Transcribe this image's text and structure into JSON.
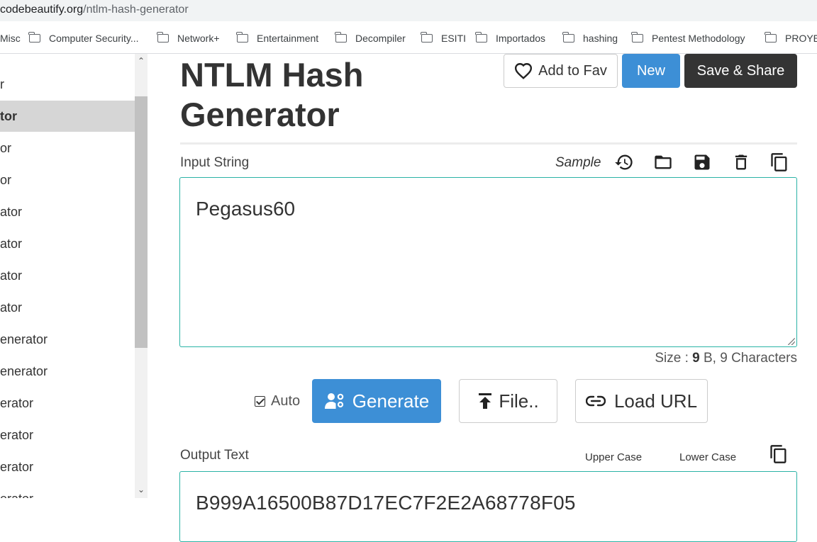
{
  "browser": {
    "url_host": "codebeautify.org",
    "url_path": "/ntlm-hash-generator"
  },
  "bookmarks": [
    {
      "label": "Misc",
      "icon": "folder-icon"
    },
    {
      "label": "Computer Security...",
      "icon": "folder-icon"
    },
    {
      "label": "Network+",
      "icon": "folder-icon"
    },
    {
      "label": "Entertainment",
      "icon": "folder-icon"
    },
    {
      "label": "Decompiler",
      "icon": "folder-icon"
    },
    {
      "label": "ESITI",
      "icon": "folder-icon"
    },
    {
      "label": "Importados",
      "icon": "folder-icon"
    },
    {
      "label": "hashing",
      "icon": "folder-icon"
    },
    {
      "label": "Pentest Methodology",
      "icon": "folder-icon"
    },
    {
      "label": "PROYEC",
      "icon": "folder-icon"
    }
  ],
  "sidebar": {
    "items": [
      {
        "label": "r"
      },
      {
        "label": "tor",
        "active": true
      },
      {
        "label": "or"
      },
      {
        "label": "or"
      },
      {
        "label": "ator"
      },
      {
        "label": "ator"
      },
      {
        "label": "ator"
      },
      {
        "label": "ator"
      },
      {
        "label": "enerator"
      },
      {
        "label": "enerator"
      },
      {
        "label": "erator"
      },
      {
        "label": "erator"
      },
      {
        "label": "erator"
      },
      {
        "label": "erator"
      }
    ]
  },
  "main": {
    "title": "NTLM Hash Generator",
    "add_to_fav": "Add to Fav",
    "new_label": "New",
    "save_share_label": "Save & Share",
    "input_label": "Input String",
    "sample_label": "Sample",
    "input_value": "Pegasus60",
    "size_prefix": "Size : ",
    "size_bytes": "9",
    "size_suffix": " B, 9 Characters",
    "auto_label": "Auto",
    "auto_checked": true,
    "generate_label": "Generate",
    "file_label": "File..",
    "load_url_label": "Load URL",
    "output_label": "Output Text",
    "upper_case_label": "Upper Case",
    "lower_case_label": "Lower Case",
    "output_value": "B999A16500B87D17EC7F2E2A68778F05"
  },
  "colors": {
    "primary": "#3d8fd6",
    "dark_button": "#343434",
    "input_border": "#2ab3a6"
  }
}
